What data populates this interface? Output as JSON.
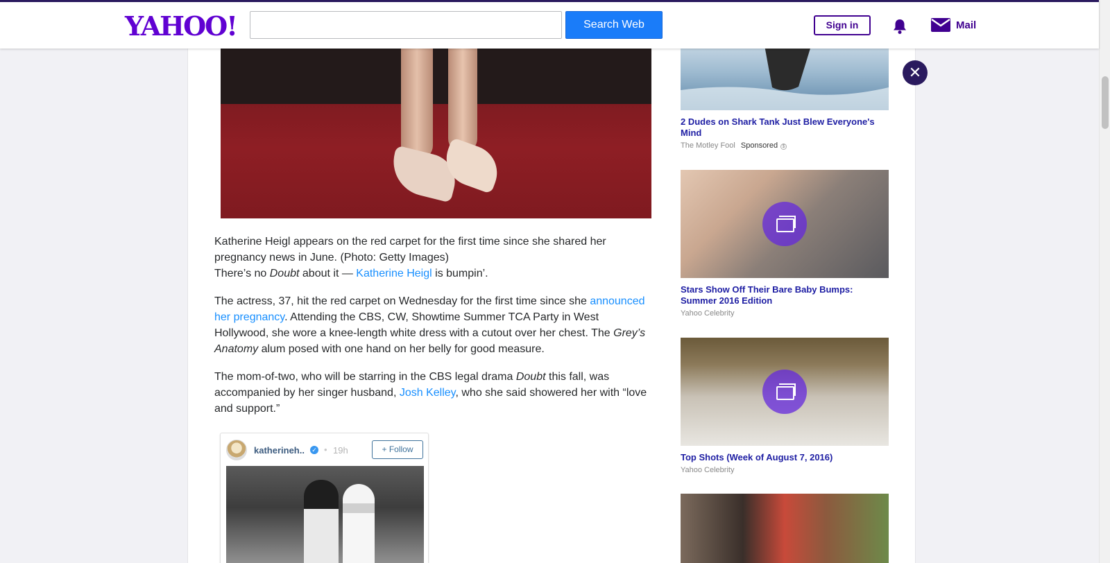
{
  "header": {
    "logo": "YAHOO!",
    "search_value": "",
    "search_button": "Search Web",
    "signin_label": "Sign in",
    "mail_label": "Mail"
  },
  "article": {
    "caption": "Katherine Heigl appears on the red carpet for the first time since she shared her pregnancy news in June. (Photo: Getty Images)",
    "p1_before": "There’s no ",
    "p1_italic": "Doubt",
    "p1_mid": " about it — ",
    "p1_link": "Katherine Heigl",
    "p1_after": " is bumpin’.",
    "p2_before": "The actress, 37, hit the red carpet on Wednesday for the first time since she ",
    "p2_link": "announced her pregnancy",
    "p2_mid": ". Attending the CBS, CW, Showtime Summer TCA Party in West Hollywood, she wore a knee-length white dress with a cutout over her chest. The ",
    "p2_italic": "Grey’s Anatomy",
    "p2_after": " alum posed with one hand on her belly for good measure.",
    "p3_before": "The mom-of-two, who will be starring in the CBS legal drama ",
    "p3_italic": "Doubt",
    "p3_mid": " this fall, was accompanied by her singer husband, ",
    "p3_link": "Josh Kelley",
    "p3_after": ", who she said showered her with “love and support.”"
  },
  "instagram": {
    "username": "katherineh..",
    "dot": "•",
    "time": "19h",
    "follow_label": "+ Follow"
  },
  "sidebar": {
    "ads": [
      {
        "title": "2 Dudes on Shark Tank Just Blew Everyone's Mind",
        "source": "The Motley Fool",
        "sponsored": "Sponsored"
      },
      {
        "title": "Stars Show Off Their Bare Baby Bumps: Summer 2016 Edition",
        "source": "Yahoo Celebrity"
      },
      {
        "title": "Top Shots (Week of August 7, 2016)",
        "source": "Yahoo Celebrity"
      }
    ]
  },
  "close_label": "✕",
  "colors": {
    "brand_purple": "#6001d2",
    "search_blue": "#1a7cf9",
    "link_blue": "#188fff",
    "sidebar_title": "#1d1da3",
    "dark_purple": "#2a1a5e"
  }
}
